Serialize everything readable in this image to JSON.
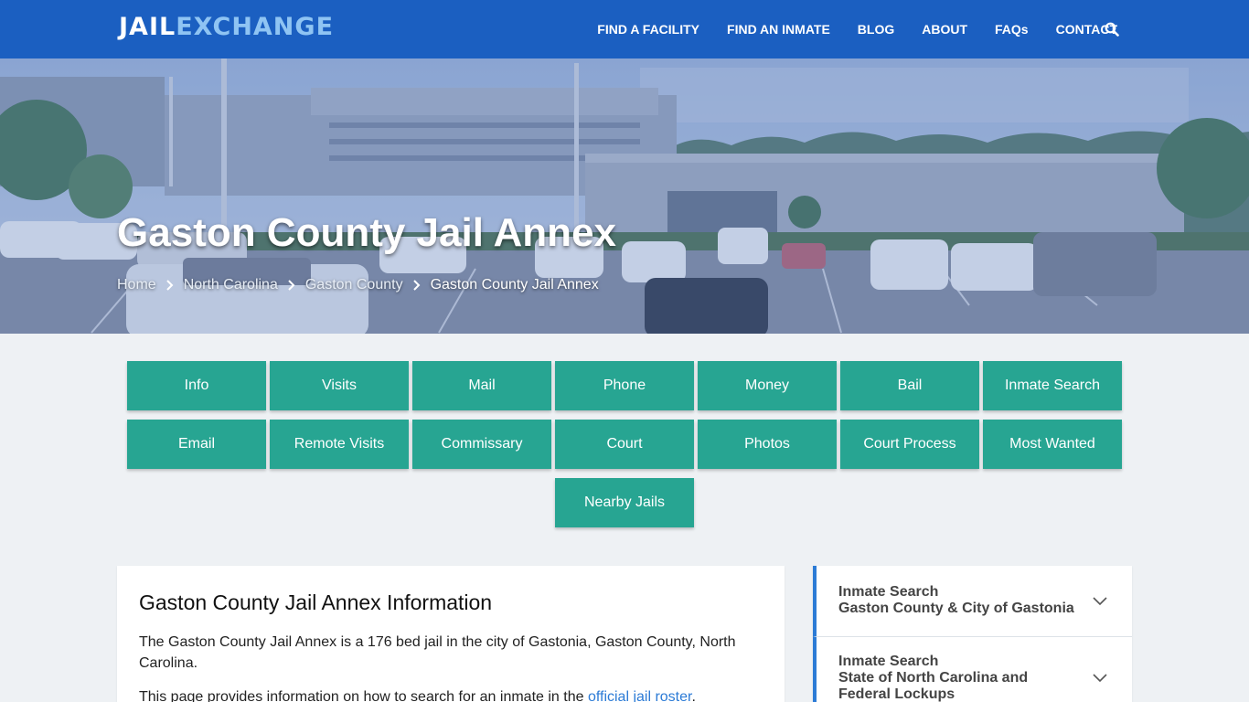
{
  "brand": {
    "logo_part1": "JAIL",
    "logo_part2": "EXCHANGE"
  },
  "nav": {
    "items": [
      "FIND A FACILITY",
      "FIND AN INMATE",
      "BLOG",
      "ABOUT",
      "FAQs",
      "CONTACT"
    ],
    "search_icon": "search-icon"
  },
  "hero": {
    "title": "Gaston County Jail Annex",
    "breadcrumb": [
      "Home",
      "North Carolina",
      "Gaston County",
      "Gaston County Jail Annex"
    ]
  },
  "buttons": {
    "row1": [
      "Info",
      "Visits",
      "Mail",
      "Phone",
      "Money",
      "Bail",
      "Inmate Search"
    ],
    "row2": [
      "Email",
      "Remote Visits",
      "Commissary",
      "Court",
      "Photos",
      "Court Process",
      "Most Wanted"
    ],
    "row3": [
      "Nearby Jails"
    ]
  },
  "main": {
    "heading": "Gaston County Jail Annex Information",
    "para1": "The Gaston County Jail Annex is a 176 bed jail in the city of Gastonia, Gaston County, North Carolina.",
    "para2_prefix": "This page provides information on how to search for an inmate in the ",
    "para2_link": "official jail roster",
    "para2_suffix": "."
  },
  "sidebar": {
    "items": [
      {
        "title": "Inmate Search",
        "subtitle": "Gaston County & City of Gastonia"
      },
      {
        "title": "Inmate Search",
        "subtitle": "State of North Carolina and Federal Lockups"
      }
    ]
  },
  "colors": {
    "nav": "#1b5fc1",
    "button": "#27a592",
    "accent": "#2c7bd6",
    "logo_accent": "#8fc4f3"
  }
}
